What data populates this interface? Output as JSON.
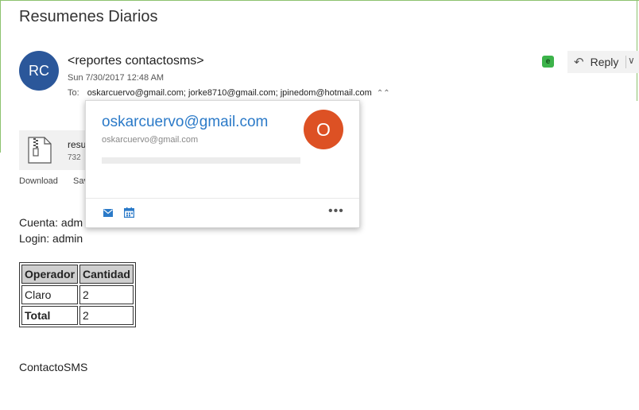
{
  "email": {
    "subject": "Resumenes Diarios",
    "avatar_initials": "RC",
    "sender": "<reportes contactosms>",
    "date": "Sun 7/30/2017 12:48 AM",
    "to_label": "To:",
    "recipients": "oskarcuervo@gmail.com;  jorke8710@gmail.com;  jpinedom@hotmail.com",
    "expand_glyph": "⌃⌃"
  },
  "toolbar": {
    "reply_label": "Reply",
    "reply_arrow": "↶",
    "reply_chevron": "∨",
    "evernote_glyph": "e"
  },
  "attachment": {
    "name_visible": "resu",
    "size_visible": "732",
    "download_label": "Download",
    "save_label_visible": "Sav"
  },
  "body": {
    "cuenta_visible": "Cuenta: adm",
    "login": "Login: admin",
    "table": {
      "headers": [
        "Operador",
        "Cantidad"
      ],
      "rows": [
        [
          "Claro",
          "2"
        ],
        [
          "Total",
          "2"
        ]
      ]
    },
    "footer": "ContactoSMS"
  },
  "contact_card": {
    "email": "oskarcuervo@gmail.com",
    "sub_email": "oskarcuervo@gmail.com",
    "avatar_initial": "O",
    "more_glyph": "•••"
  },
  "colors": {
    "avatar_blue": "#2b579a",
    "card_avatar_orange": "#dd5124",
    "link_blue": "#2b7ac8",
    "frame_green": "#8dc26f",
    "evernote_green": "#3cb34a"
  }
}
